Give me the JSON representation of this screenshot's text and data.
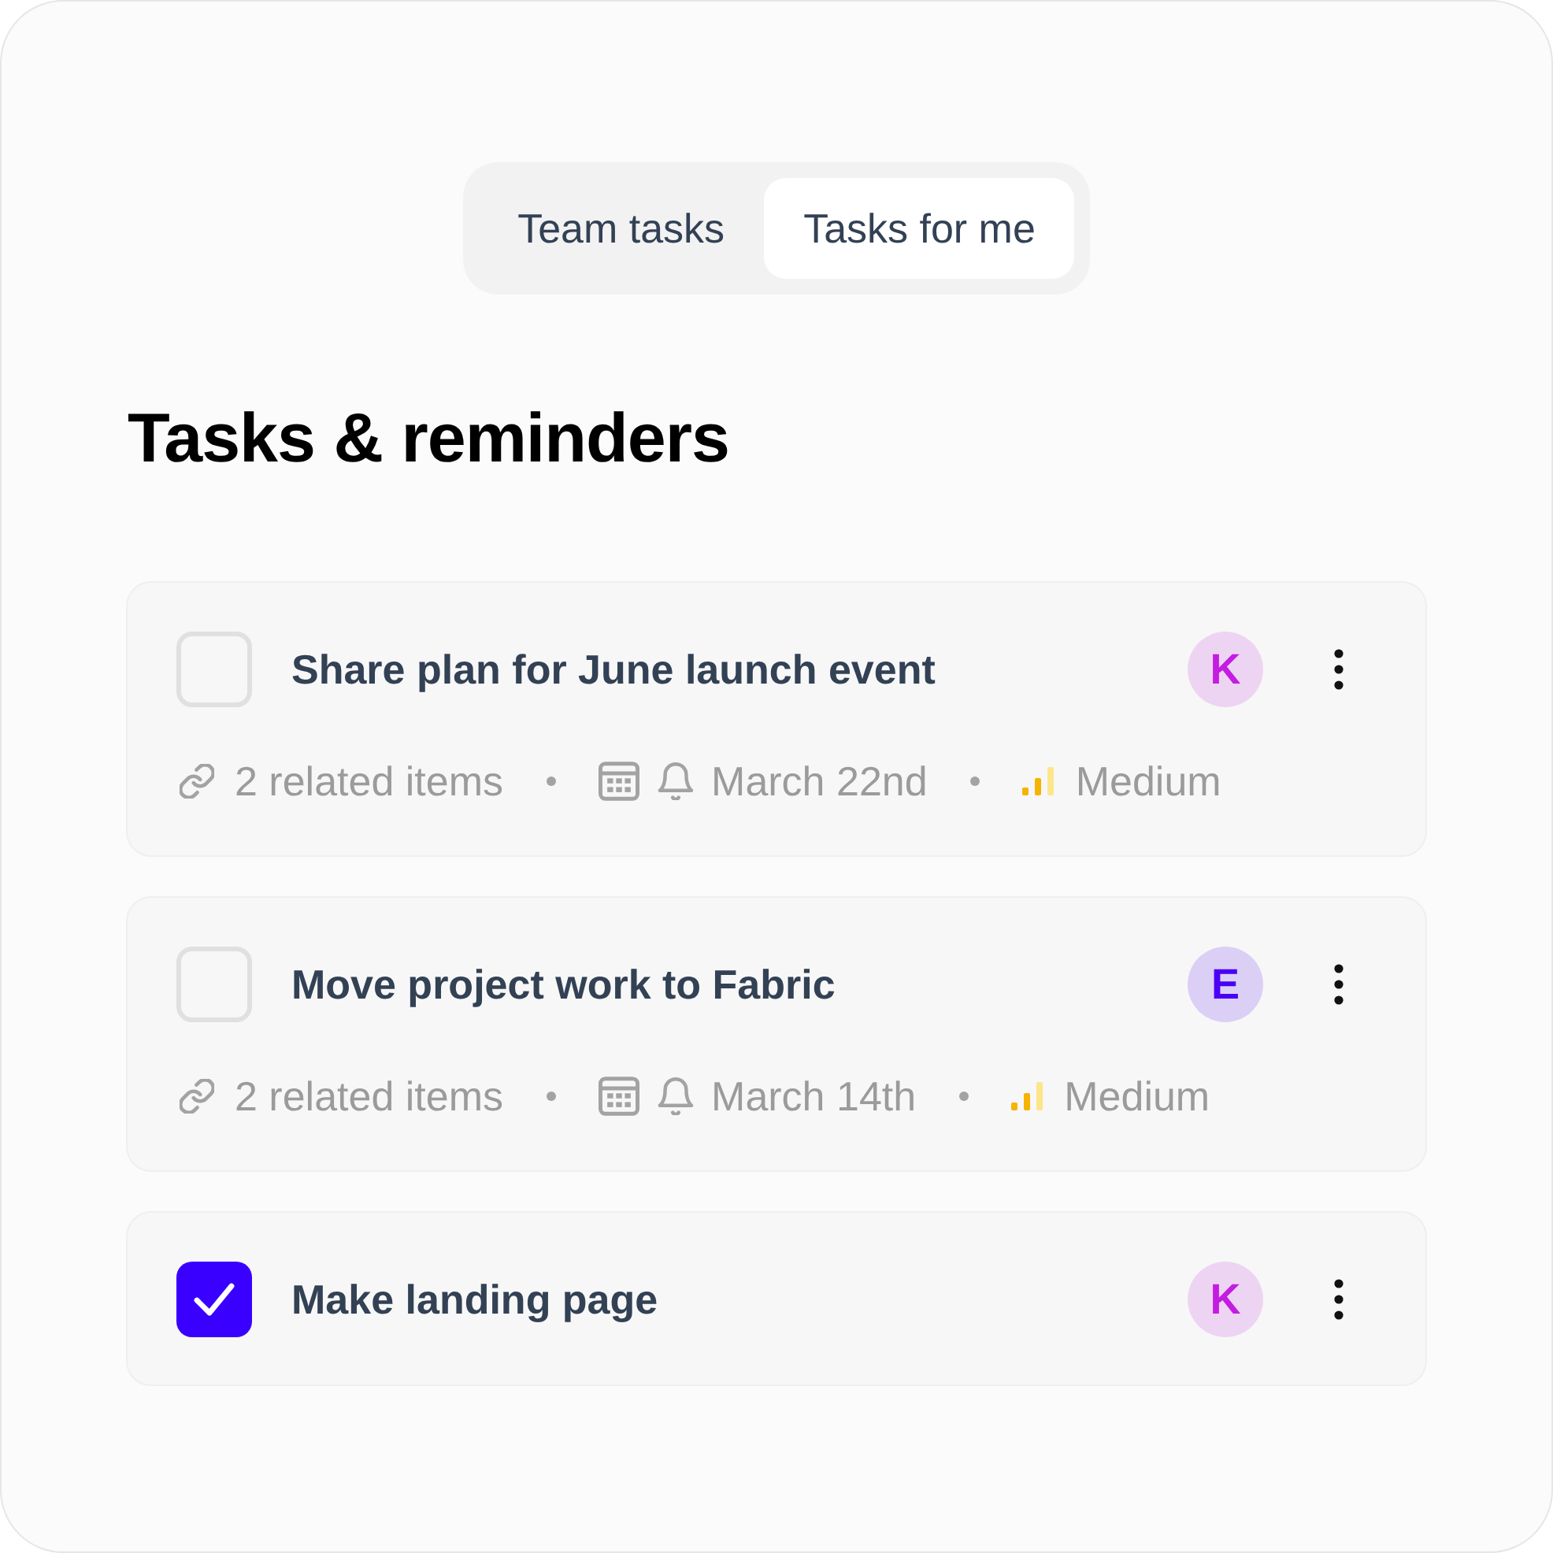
{
  "tabs": [
    {
      "label": "Team tasks",
      "selected": false
    },
    {
      "label": "Tasks for me",
      "selected": true
    }
  ],
  "heading": "Tasks & reminders",
  "tasks": [
    {
      "title": "Share plan for June launch event",
      "checked": false,
      "assignee": {
        "initial": "K",
        "color": "#c21de0"
      },
      "related": "2 related items",
      "due": "March 22nd",
      "priority": "Medium"
    },
    {
      "title": "Move project work to Fabric",
      "checked": false,
      "assignee": {
        "initial": "E",
        "color": "#4a00f5"
      },
      "related": "2 related items",
      "due": "March 14th",
      "priority": "Medium"
    },
    {
      "title": "Make landing page",
      "checked": true,
      "assignee": {
        "initial": "K",
        "color": "#c21de0"
      }
    }
  ]
}
